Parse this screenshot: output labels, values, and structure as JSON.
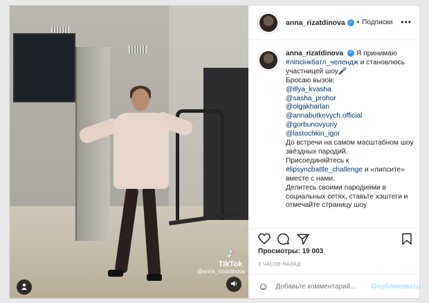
{
  "header": {
    "username": "anna_rizatdinova",
    "separator": "•",
    "follow_label": "Подписки",
    "more_icon": "more-icon"
  },
  "caption": {
    "username": "anna_rizatdinova",
    "intro": "Я принимаю",
    "hashtag": "#ліпсінкбатл_челендж",
    "intro2": "и становлюсь участницей шоу",
    "challenge_text": "Бросаю вызов:",
    "mentions": [
      "@illya_kvasha",
      "@sasha_prohor",
      "@olgakharlan",
      "@annabutkevych.official",
      "@gorbunovyuriy",
      "@lastochkin_igor"
    ],
    "body1": "До встречи на самом масштабном шоу звёздных пародий.",
    "body2_prefix": "Присоединяйтесь к",
    "body2_tag": "#lipsyncbattle_challenge",
    "body2_suffix": "и «липсите» вместе с нами.",
    "body3": "Делитесь своими пародиями в социальных сетях, ставьте хэштеги и отмечайте страницу шоу"
  },
  "media": {
    "tiktok_label": "TikTok",
    "tiktok_user": "@anna_rizatdinova"
  },
  "stats": {
    "views": "Просмотры: 19 003",
    "time": "3 ЧАСОВ НАЗАД"
  },
  "comment": {
    "placeholder": "Добавьте комментарий...",
    "publish_label": "Опубликовать"
  },
  "colors": {
    "link": "#00376b",
    "verified": "#3897f0",
    "publish_disabled": "#b2dffc"
  }
}
